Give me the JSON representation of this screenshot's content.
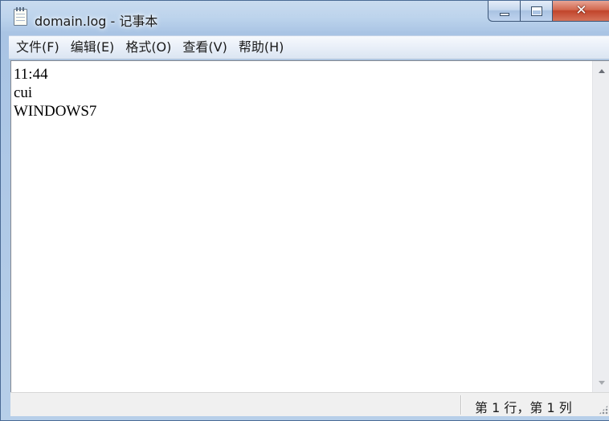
{
  "window": {
    "title": "domain.log - 记事本",
    "icon": "notepad-icon",
    "close_symbol": "✕"
  },
  "menu": {
    "items": [
      {
        "label": "文件(F)"
      },
      {
        "label": "编辑(E)"
      },
      {
        "label": "格式(O)"
      },
      {
        "label": "查看(V)"
      },
      {
        "label": "帮助(H)"
      }
    ]
  },
  "editor": {
    "lines": [
      "11:44",
      "cui",
      "WINDOWS7"
    ]
  },
  "status": {
    "position": "第 1 行，第 1 列"
  },
  "colors": {
    "close_button": "#c1442b",
    "frame": "#b9d1ea"
  }
}
